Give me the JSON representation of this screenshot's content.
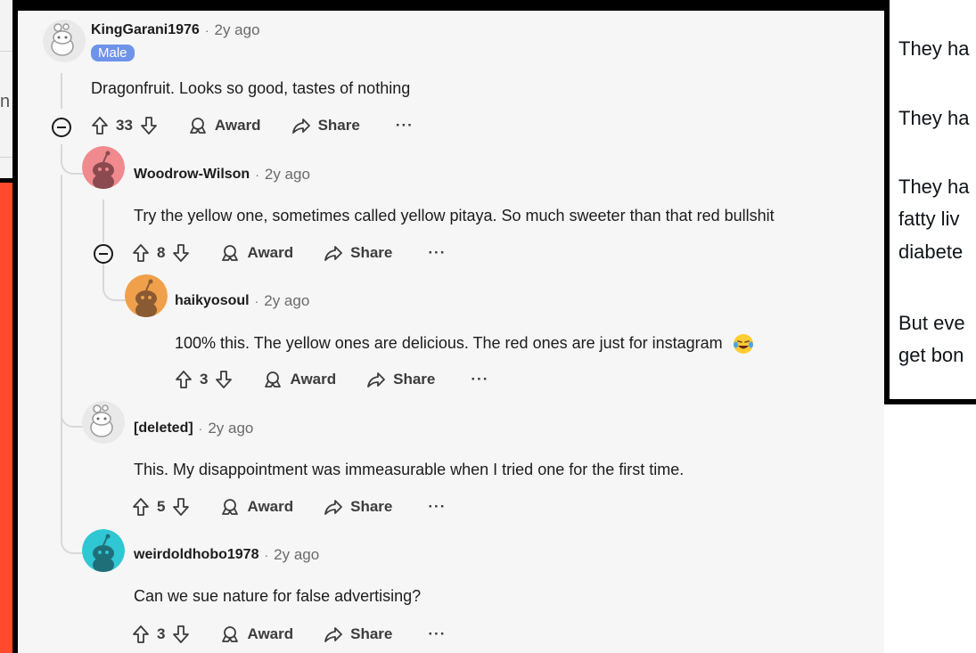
{
  "comments": [
    {
      "username": "KingGarani1976",
      "time": "2y ago",
      "flair": "Male",
      "text": "Dragonfruit. Looks so good, tastes of nothing",
      "votes": "33",
      "award": "Award",
      "share": "Share",
      "more": "···",
      "avatar_color": "#e9e9e9"
    },
    {
      "username": "Woodrow-Wilson",
      "time": "2y ago",
      "text": "Try the yellow one, sometimes called yellow pitaya. So much sweeter than that red bullshit",
      "votes": "8",
      "award": "Award",
      "share": "Share",
      "more": "···",
      "avatar_color": "#f08a8f"
    },
    {
      "username": "haikyosoul",
      "time": "2y ago",
      "text": "100% this. The yellow ones are delicious. The red ones are just for instagram",
      "votes": "3",
      "award": "Award",
      "share": "Share",
      "more": "···",
      "avatar_color": "#f0a04b"
    },
    {
      "username": "[deleted]",
      "time": "2y ago",
      "text": "This. My disappointment was immeasurable when I tried one for the first time.",
      "votes": "5",
      "award": "Award",
      "share": "Share",
      "more": "···",
      "avatar_color": "#e9e9e9"
    },
    {
      "username": "weirdoldhobo1978",
      "time": "2y ago",
      "text": "Can we sue nature for false advertising?",
      "votes": "3",
      "award": "Award",
      "share": "Share",
      "more": "···",
      "avatar_color": "#2fc7d4"
    }
  ],
  "separator": "·",
  "tweet_fragments": [
    "They ha",
    "They ha",
    "They ha",
    "fatty liv",
    "diabete",
    "But eve",
    "get bon"
  ],
  "left_fragment": "n"
}
